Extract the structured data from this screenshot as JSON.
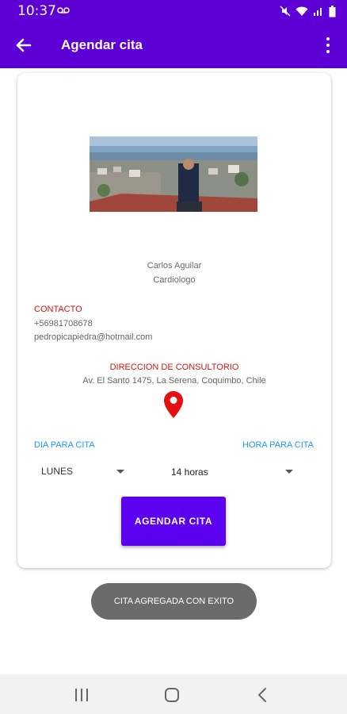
{
  "status_bar": {
    "time": "10:37",
    "icons": [
      "voicemail-icon",
      "mute-icon",
      "wifi-icon",
      "signal-icon",
      "battery-icon"
    ]
  },
  "app_bar": {
    "title": "Agendar cita",
    "back_icon": "arrow-left-icon",
    "menu_icon": "more-vert-icon"
  },
  "doctor": {
    "name": "Carlos Aguilar",
    "specialty": "Cardiologo"
  },
  "contact": {
    "title": "CONTACTO",
    "phone": "+56981708678",
    "email": "pedropicapiedra@hotmail.com"
  },
  "address": {
    "title": "DIRECCION DE CONSULTORIO",
    "text": "Av. El Santo 1475, La Serena, Coquimbo, Chile",
    "icon": "map-pin-icon"
  },
  "schedule": {
    "day_label": "DIA PARA CITA",
    "hour_label": "HORA PARA CITA",
    "day_value": "LUNES",
    "hour_value": "14 horas"
  },
  "button": {
    "label": "AGENDAR CITA"
  },
  "toast": {
    "text": "CITA AGREGADA CON EXITO"
  },
  "colors": {
    "primary": "#5c00d6",
    "button": "#5c00f0",
    "accent_red": "#d01616",
    "link_blue": "#2196f3",
    "toast_bg": "#6b6b6b"
  }
}
